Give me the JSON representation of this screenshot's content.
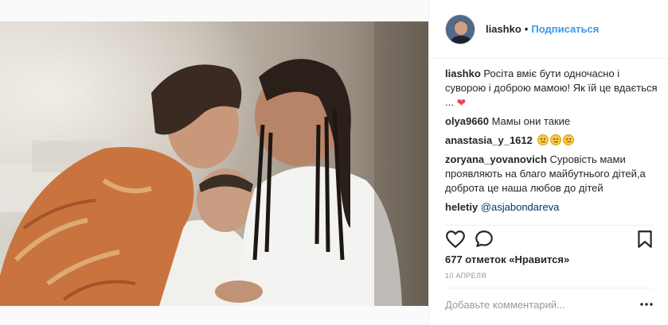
{
  "post": {
    "author": "liashko",
    "separator": "•",
    "follow_label": "Подписаться"
  },
  "caption": {
    "user": "liashko",
    "text": "Росіта вміє бути одночасно і суворою і доброю мамою! Як їй це вдається ...",
    "emoji": "heart"
  },
  "comments": [
    {
      "user": "olya9660",
      "text": "Мамы они такие"
    },
    {
      "user": "anastasia_y_1612",
      "text": "",
      "emoji": [
        "neutral-face",
        "neutral-face",
        "neutral-face"
      ]
    },
    {
      "user": "zoryana_yovanovich",
      "text": "Суровість мами проявляють на благо майбутнього дітей,а доброта це наша любов до дітей"
    },
    {
      "user": "heletiy",
      "mention": "@asjabondareva"
    }
  ],
  "actions": {
    "like_icon": "heart-outline-icon",
    "comment_icon": "speech-bubble-icon",
    "save_icon": "bookmark-icon"
  },
  "likes_text": "677 отметок «Нравится»",
  "date": "10 апреля",
  "add_comment": {
    "placeholder": "Добавьте комментарий...",
    "value": ""
  },
  "colors": {
    "link": "#3897f0",
    "heart": "#ed4956",
    "mention": "#003569",
    "muted": "#999999"
  }
}
